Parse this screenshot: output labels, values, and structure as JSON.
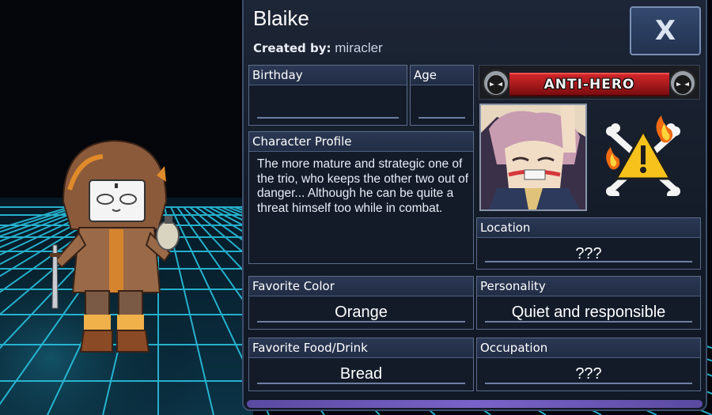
{
  "character": {
    "name": "Blaike",
    "created_by_label": "Created by:",
    "creator": "miracler"
  },
  "close_button": {
    "label": "X"
  },
  "fields": {
    "birthday": {
      "label": "Birthday",
      "value": ""
    },
    "age": {
      "label": "Age",
      "value": ""
    },
    "profile": {
      "label": "Character Profile",
      "text": "The more mature and strategic one of the trio, who keeps the other two out of danger... Although he can be quite a threat himself too while in combat."
    },
    "location": {
      "label": "Location",
      "value": "???"
    },
    "favorite_color": {
      "label": "Favorite Color",
      "value": "Orange"
    },
    "personality": {
      "label": "Personality",
      "value": "Quiet and responsible"
    },
    "favorite_food": {
      "label": "Favorite Food/Drink",
      "value": "Bread"
    },
    "occupation": {
      "label": "Occupation",
      "value": "???"
    }
  },
  "badge": {
    "text": "ANTI-HERO",
    "color": "#c4191d"
  },
  "icons": {
    "close": "close-icon",
    "badge_left": "mask-icon",
    "badge_right": "mask-icon",
    "warning": "warning-skull-icon"
  },
  "colors": {
    "panel_bg": "#171f2e",
    "panel_border": "#3d4d6c",
    "header_bg": "#27334c",
    "grid_cyan": "#29c7e6"
  }
}
